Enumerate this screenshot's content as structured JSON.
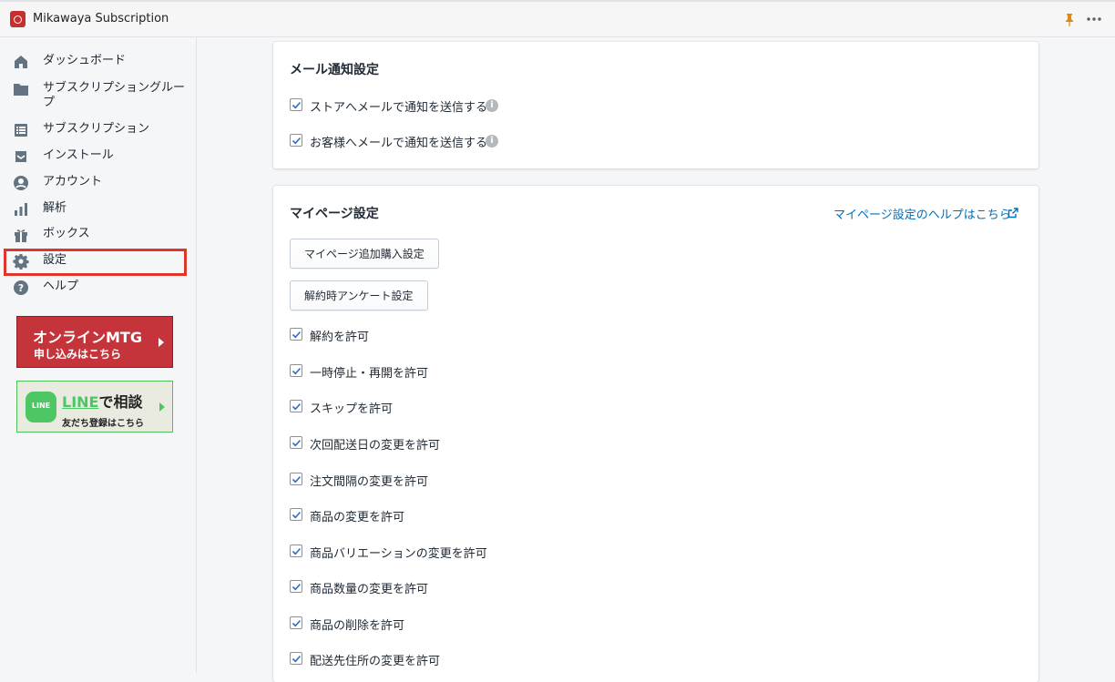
{
  "app": {
    "title": "Mikawaya Subscription"
  },
  "colors": {
    "accent_link": "#006fbb",
    "highlight": "#e0352b",
    "mtg_banner": "#c4343a",
    "line_green": "#4cc764"
  },
  "sidebar": {
    "items": [
      {
        "label": "ダッシュボード",
        "icon": "home-icon"
      },
      {
        "label": "サブスクリプショングループ",
        "icon": "folder-icon"
      },
      {
        "label": "サブスクリプション",
        "icon": "list-icon"
      },
      {
        "label": "インストール",
        "icon": "inbox-icon"
      },
      {
        "label": "アカウント",
        "icon": "user-icon"
      },
      {
        "label": "解析",
        "icon": "analytics-icon"
      },
      {
        "label": "ボックス",
        "icon": "gift-icon"
      },
      {
        "label": "設定",
        "icon": "gear-icon",
        "active": true
      },
      {
        "label": "ヘルプ",
        "icon": "help-icon"
      }
    ],
    "banner_mtg": {
      "line1": "オンラインMTG",
      "line2": "申し込みはこちら"
    },
    "banner_line": {
      "logo": "LINE",
      "brand": "LINE",
      "suffix": "で相談",
      "line2": "友だち登録はこちら"
    }
  },
  "email_settings": {
    "title": "メール通知設定",
    "options": [
      {
        "label": "ストアへメールで通知を送信する",
        "checked": true
      },
      {
        "label": "お客様へメールで通知を送信する",
        "checked": true
      }
    ]
  },
  "mypage_settings": {
    "title": "マイページ設定",
    "help_link": "マイページ設定のヘルプはこちら",
    "buttons": [
      {
        "label": "マイページ追加購入設定"
      },
      {
        "label": "解約時アンケート設定"
      }
    ],
    "options": [
      {
        "label": "解約を許可",
        "checked": true
      },
      {
        "label": "一時停止・再開を許可",
        "checked": true
      },
      {
        "label": "スキップを許可",
        "checked": true
      },
      {
        "label": "次回配送日の変更を許可",
        "checked": true
      },
      {
        "label": "注文間隔の変更を許可",
        "checked": true
      },
      {
        "label": "商品の変更を許可",
        "checked": true
      },
      {
        "label": "商品バリエーションの変更を許可",
        "checked": true
      },
      {
        "label": "商品数量の変更を許可",
        "checked": true
      },
      {
        "label": "商品の削除を許可",
        "checked": true
      },
      {
        "label": "配送先住所の変更を許可",
        "checked": true
      }
    ]
  }
}
